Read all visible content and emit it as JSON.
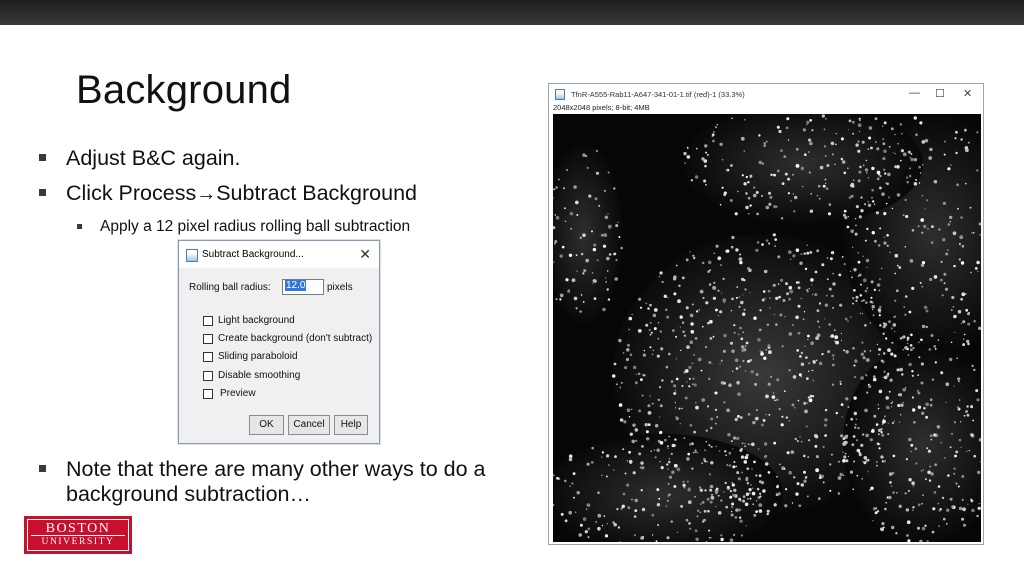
{
  "slide": {
    "title": "Background",
    "bullets": {
      "adjust": "Adjust B&C again.",
      "click_prefix": "Click Process",
      "click_arrow": "→",
      "click_suffix": "Subtract Background",
      "apply": "Apply a 12 pixel radius rolling ball subtraction",
      "note": "Note that there are many other ways to do a background subtraction…"
    }
  },
  "dialog": {
    "title": "Subtract Background...",
    "close_glyph": "✕",
    "radius_label": "Rolling ball radius:",
    "radius_value": "12.0",
    "radius_unit": "pixels",
    "options": [
      {
        "label": "Light background",
        "checked": false
      },
      {
        "label": "Create background (don't subtract)",
        "checked": false
      },
      {
        "label": "Sliding paraboloid",
        "checked": false
      },
      {
        "label": "Disable smoothing",
        "checked": false
      },
      {
        "label": "Preview",
        "checked": false
      }
    ],
    "buttons": {
      "ok": "OK",
      "cancel": "Cancel",
      "help": "Help"
    }
  },
  "image_window": {
    "title": "TfnR-A555-Rab11-A647-341-01-1.tif (red)-1 (33.3%)",
    "info": "2048x2048 pixels; 8-bit; 4MB",
    "controls": {
      "minimize": "—",
      "maximize": "☐",
      "close": "✕"
    },
    "image_icon": "microscopy-image"
  },
  "logo": {
    "line1": "BOSTON",
    "line2": "UNIVERSITY",
    "color": "#c8102e"
  }
}
